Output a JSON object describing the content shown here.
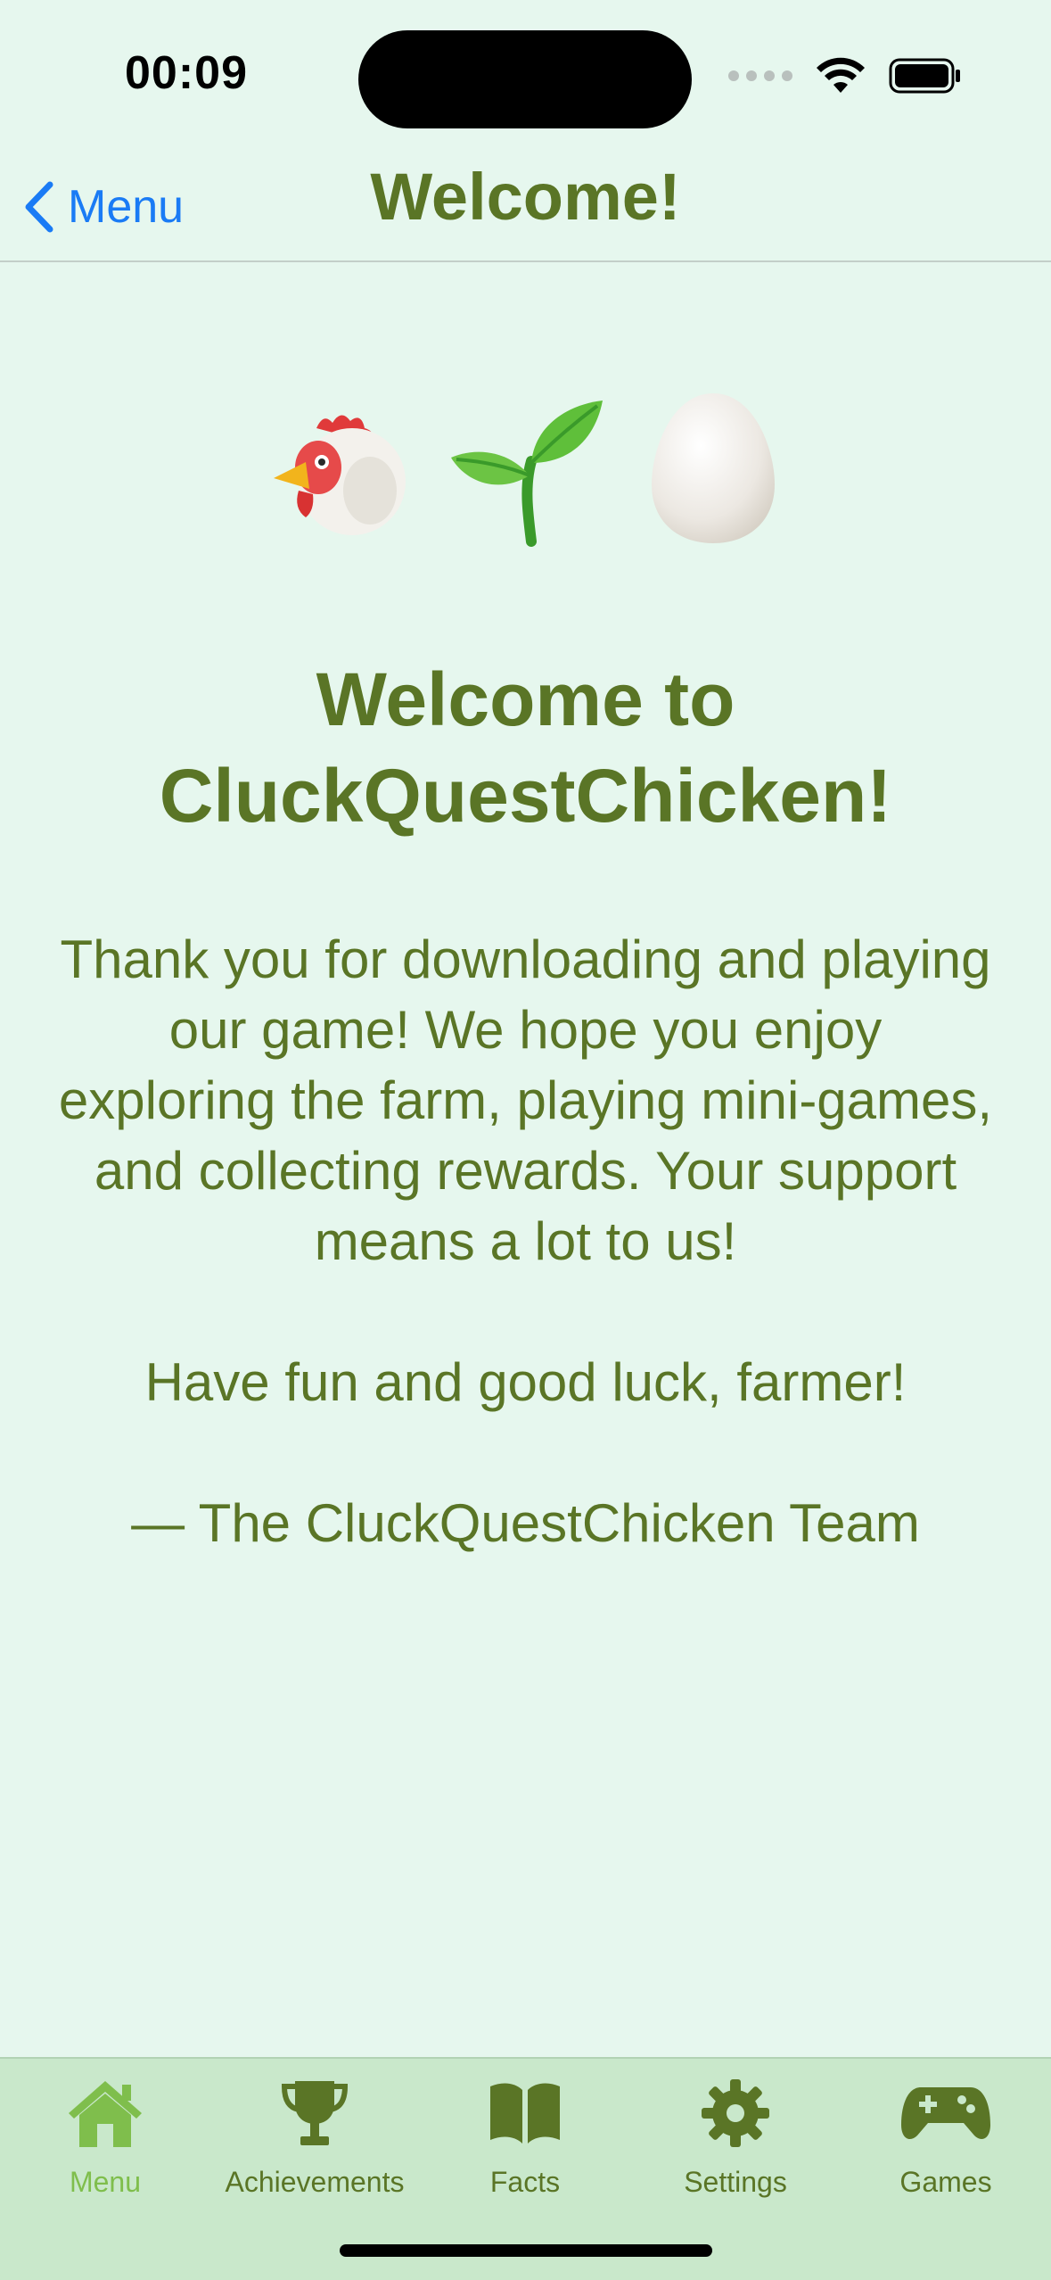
{
  "status_bar": {
    "time": "00:09"
  },
  "nav": {
    "back_label": "Menu",
    "title": "Welcome!"
  },
  "content": {
    "headline_line1": "Welcome to",
    "headline_line2": "CluckQuestChicken!",
    "paragraph": "Thank you for downloading and playing our game! We hope you enjoy exploring the farm, playing mini-games, and collecting rewards. Your support means a lot to us!",
    "wish": "Have fun and good luck, farmer!",
    "signature": "— The CluckQuestChicken Team"
  },
  "tabs": [
    {
      "label": "Menu",
      "icon": "house-icon",
      "active": true
    },
    {
      "label": "Achievements",
      "icon": "trophy-icon",
      "active": false
    },
    {
      "label": "Facts",
      "icon": "book-icon",
      "active": false
    },
    {
      "label": "Settings",
      "icon": "gear-icon",
      "active": false
    },
    {
      "label": "Games",
      "icon": "gamepad-icon",
      "active": false
    }
  ],
  "colors": {
    "background": "#e6f7ee",
    "text_green": "#5a7526",
    "link_blue": "#1a7bf5",
    "tabbar_bg": "#c9e8cb",
    "tab_active": "#7fbe4c"
  }
}
